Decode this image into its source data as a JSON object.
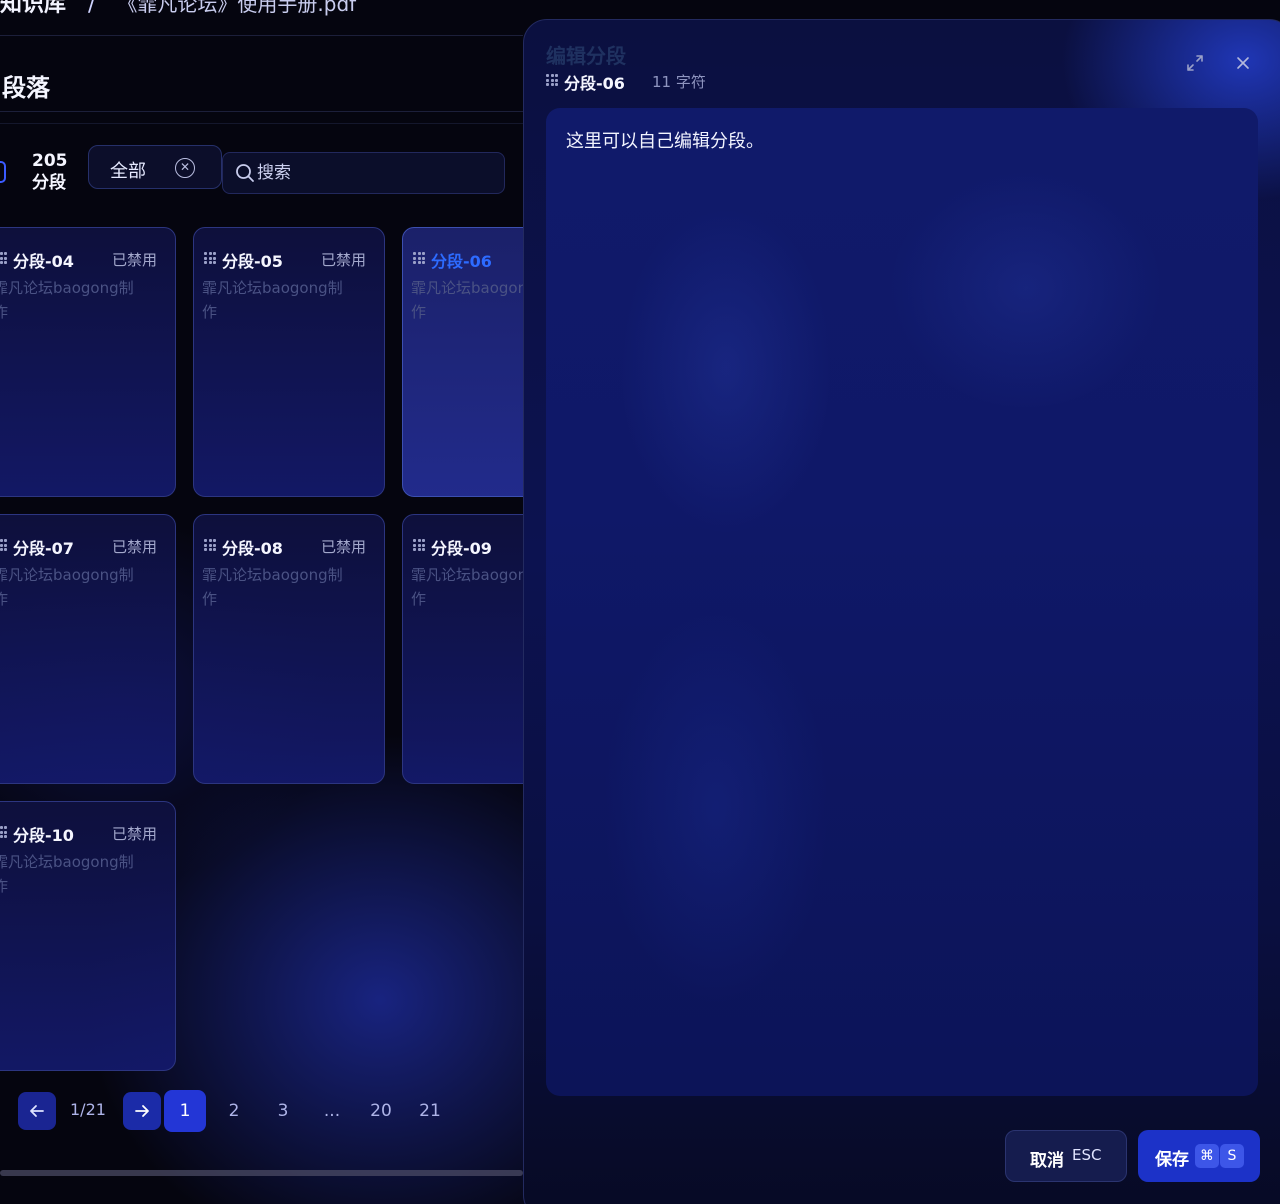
{
  "breadcrumb": {
    "root": "知识库",
    "separator": "/",
    "doc": "《霏凡论坛》使用手册.pdf"
  },
  "section": {
    "title": "段落"
  },
  "filters": {
    "count_label": "205 分段",
    "selected": "全部",
    "search_placeholder": "搜索"
  },
  "cards": [
    {
      "name": "分段-04",
      "status": "已禁用",
      "content": "霏凡论坛baogong制作"
    },
    {
      "name": "分段-05",
      "status": "已禁用",
      "content": "霏凡论坛baogong制作"
    },
    {
      "name": "分段-06",
      "status": "",
      "content": "霏凡论坛baogong制作"
    },
    {
      "name": "分段-07",
      "status": "已禁用",
      "content": "霏凡论坛baogong制作"
    },
    {
      "name": "分段-08",
      "status": "已禁用",
      "content": "霏凡论坛baogong制作"
    },
    {
      "name": "分段-09",
      "status": "",
      "content": "霏凡论坛baogong制作"
    },
    {
      "name": "分段-10",
      "status": "已禁用",
      "content": "霏凡论坛baogong制作"
    }
  ],
  "pagination": {
    "position": "1/21",
    "pages": [
      "1",
      "2",
      "3",
      "...",
      "20",
      "21"
    ],
    "current": "1"
  },
  "drawer": {
    "title": "编辑分段",
    "segment": "分段-06",
    "char_count": "11 字符",
    "content": "这里可以自己编辑分段。",
    "cancel_label": "取消",
    "cancel_key": "ESC",
    "save_label": "保存",
    "save_key_mod": "⌘",
    "save_key": "S"
  },
  "colors": {
    "accent": "#2d6bff",
    "primary_button": "#1c32c8",
    "page_bg": "#05050f"
  }
}
